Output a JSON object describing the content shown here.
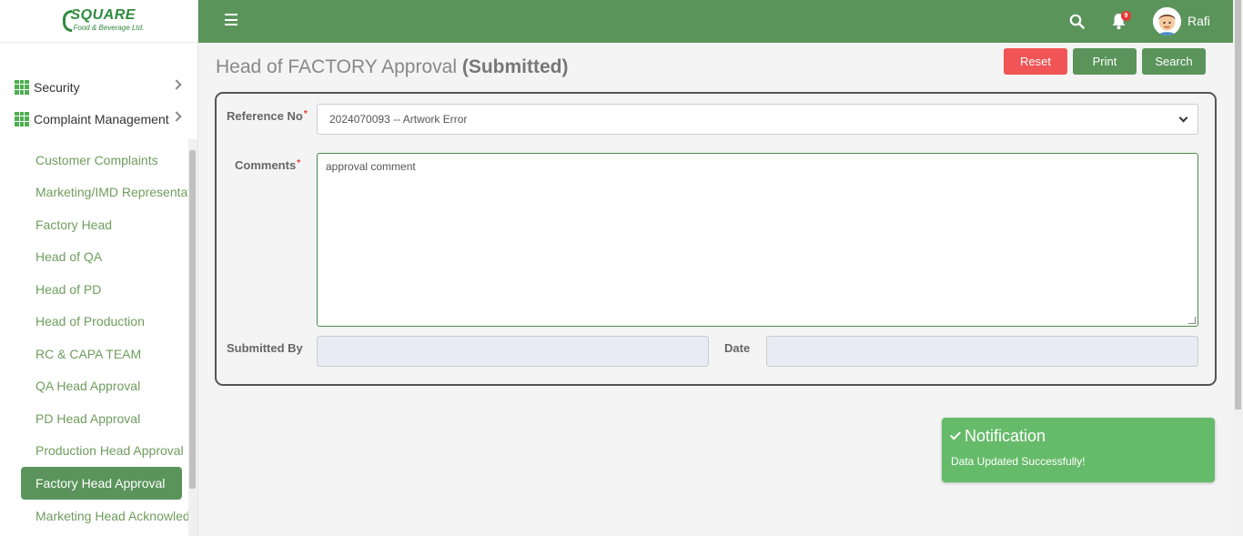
{
  "logo": {
    "title": "SQUARE",
    "subtitle": "Food & Beverage Ltd."
  },
  "sidebar": {
    "top_items": [
      {
        "label": "Security",
        "icon": "grid-icon"
      },
      {
        "label": "Complaint Management",
        "icon": "grid-icon"
      }
    ],
    "sub_items": [
      {
        "label": "Customer Complaints"
      },
      {
        "label": "Marketing/IMD Representative"
      },
      {
        "label": "Factory Head"
      },
      {
        "label": "Head of QA"
      },
      {
        "label": "Head of PD"
      },
      {
        "label": "Head of Production"
      },
      {
        "label": "RC & CAPA TEAM"
      },
      {
        "label": "QA Head Approval"
      },
      {
        "label": "PD Head Approval"
      },
      {
        "label": "Production Head Approval"
      },
      {
        "label": "Factory Head Approval",
        "active": true
      },
      {
        "label": "Marketing Head Acknowledgement"
      }
    ]
  },
  "topbar": {
    "notification_count": "9",
    "username": "Rafi"
  },
  "page": {
    "title": "Head of FACTORY Approval",
    "status": "(Submitted)"
  },
  "buttons": {
    "reset": "Reset",
    "print": "Print",
    "search": "Search"
  },
  "form": {
    "reference_label": "Reference No",
    "reference_value": "2024070093 -- Artwork Error",
    "comments_label": "Comments",
    "comments_value": "approval comment",
    "submitted_by_label": "Submitted By",
    "submitted_by_value": "",
    "date_label": "Date",
    "date_value": ""
  },
  "notification": {
    "title": "Notification",
    "message": "Data Updated Successfully!"
  },
  "colors": {
    "primary": "#5a945b",
    "danger": "#f05454",
    "success": "#66bb6a",
    "link": "#6f9d5e"
  }
}
